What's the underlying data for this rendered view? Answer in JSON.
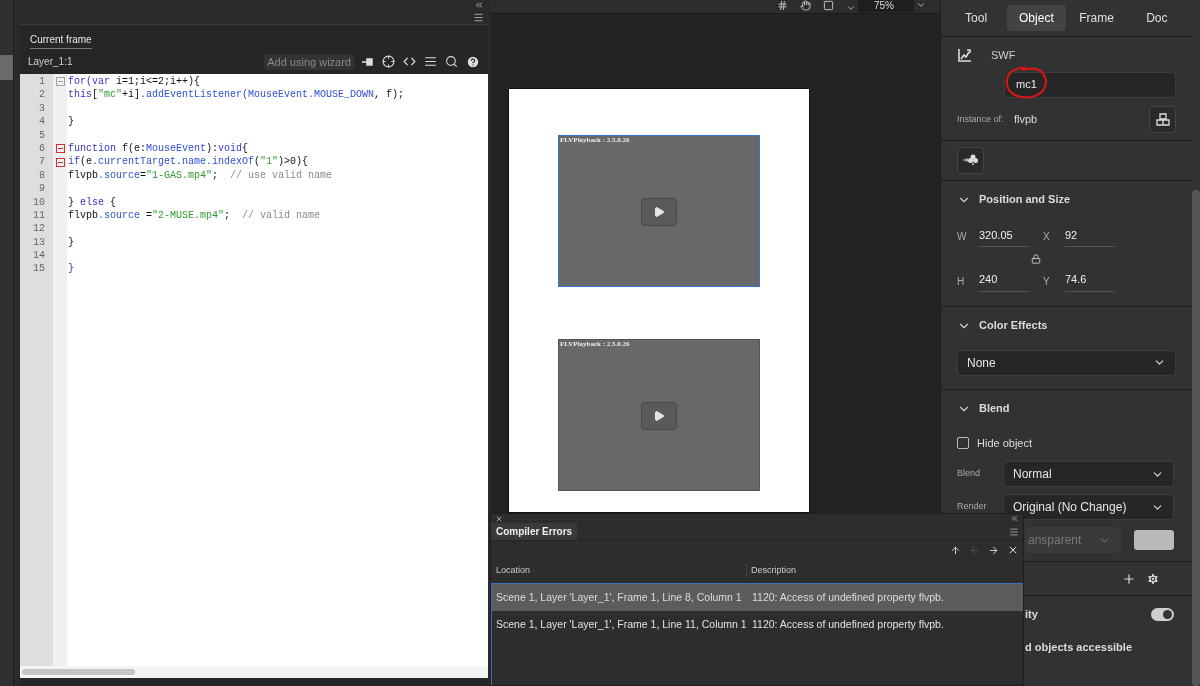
{
  "actions_panel": {
    "tab": "Current frame",
    "target": "Layer_1:1",
    "wizard_button": "Add using wizard",
    "code_lines": [
      {
        "number": "1",
        "color": "#a0a0a0",
        "segments": [
          {
            "kind": "keyword",
            "text": "for(var"
          },
          {
            "kind": "plain",
            "text": " i=1;i<=2;i++){"
          }
        ]
      },
      {
        "number": "2",
        "segments": [
          {
            "kind": "keyword",
            "text": "this"
          },
          {
            "kind": "plain",
            "text": "["
          },
          {
            "kind": "string",
            "text": "\"mc\""
          },
          {
            "kind": "plain",
            "text": "+i]"
          },
          {
            "kind": "member",
            "text": ".addEventListener(MouseEvent.MOUSE_DOWN"
          },
          {
            "kind": "plain",
            "text": ", f);"
          }
        ]
      },
      {
        "number": "3"
      },
      {
        "number": "4",
        "segments": [
          {
            "kind": "plain",
            "text": "}"
          }
        ]
      },
      {
        "number": "5"
      },
      {
        "number": "6",
        "color": "#d03030",
        "segments": [
          {
            "kind": "keyword",
            "text": "function"
          },
          {
            "kind": "plain",
            "text": " f(e:"
          },
          {
            "kind": "member",
            "text": "MouseEvent"
          },
          {
            "kind": "plain",
            "text": "):"
          },
          {
            "kind": "keyword",
            "text": "void"
          },
          {
            "kind": "plain",
            "text": "{"
          }
        ]
      },
      {
        "number": "7",
        "color": "#d03030",
        "segments": [
          {
            "kind": "keyword",
            "text": "if"
          },
          {
            "kind": "plain",
            "text": "(e"
          },
          {
            "kind": "member",
            "text": ".currentTarget.name.indexOf"
          },
          {
            "kind": "plain",
            "text": "("
          },
          {
            "kind": "string",
            "text": "\"1\""
          },
          {
            "kind": "plain",
            "text": ")>0){"
          }
        ]
      },
      {
        "number": "8",
        "segments": [
          {
            "kind": "plain",
            "text": "flvpb"
          },
          {
            "kind": "member",
            "text": ".source"
          },
          {
            "kind": "plain",
            "text": "="
          },
          {
            "kind": "string",
            "text": "\"1-GAS.mp4\""
          },
          {
            "kind": "plain",
            "text": ";  "
          },
          {
            "kind": "comment",
            "text": "// use valid name"
          }
        ]
      },
      {
        "number": "9"
      },
      {
        "number": "10",
        "segments": [
          {
            "kind": "plain",
            "text": "} "
          },
          {
            "kind": "keyword",
            "text": "else"
          },
          {
            "kind": "plain",
            "text": " {"
          }
        ]
      },
      {
        "number": "11",
        "segments": [
          {
            "kind": "plain",
            "text": "flvpb"
          },
          {
            "kind": "member",
            "text": ".source"
          },
          {
            "kind": "plain",
            "text": " ="
          },
          {
            "kind": "string",
            "text": "\"2-MUSE.mp4\""
          },
          {
            "kind": "plain",
            "text": ";  "
          },
          {
            "kind": "comment",
            "text": "// valid name"
          }
        ]
      },
      {
        "number": "12"
      },
      {
        "number": "13",
        "segments": [
          {
            "kind": "plain",
            "text": "}"
          }
        ]
      },
      {
        "number": "14"
      },
      {
        "number": "15",
        "segments": [
          {
            "kind": "keyword",
            "text": "}"
          }
        ]
      }
    ]
  },
  "stage": {
    "zoom": "75%",
    "players": [
      {
        "label": "FLVPlayback : 2.5.0.26",
        "selected": true
      },
      {
        "label": "FLVPlayback : 2.5.0.26",
        "selected": false
      }
    ]
  },
  "properties": {
    "tabs": [
      {
        "label": "Tool",
        "selected": false
      },
      {
        "label": "Object",
        "selected": true
      },
      {
        "label": "Frame",
        "selected": false
      },
      {
        "label": "Doc",
        "selected": false
      }
    ],
    "symbol_type": "SWF",
    "instance_name": "mc1",
    "instance_of_label": "Instance of:",
    "instance_of": "flvpb",
    "position_size": {
      "title": "Position and Size",
      "expanded": true,
      "fields": [
        {
          "label": "W",
          "value": "320.05"
        },
        {
          "label": "X",
          "value": "92"
        },
        {
          "label": "H",
          "value": "240"
        },
        {
          "label": "Y",
          "value": "74.6"
        }
      ]
    },
    "color_effects": {
      "title": "Color Effects",
      "expanded": true,
      "value": "None"
    },
    "blend": {
      "title": "Blend",
      "expanded": true,
      "hide_object": {
        "label": "Hide object",
        "checked": false
      },
      "blend": {
        "label": "Blend",
        "value": "Normal"
      },
      "render": {
        "label": "Render",
        "value": "Original (No Change)"
      },
      "background": {
        "value": "ansparent",
        "disabled": true
      }
    },
    "accessibility": {
      "label": "ity",
      "on": true
    },
    "accessible_note": "d objects accessible"
  },
  "compiler_errors": {
    "title": "Compiler Errors",
    "columns": [
      "Location",
      "Description"
    ],
    "rows": [
      {
        "location": "Scene 1, Layer 'Layer_1', Frame 1, Line 8, Column 1",
        "description": "1120: Access of undefined property flvpb.",
        "selected": true
      },
      {
        "location": "Scene 1, Layer 'Layer_1', Frame 1, Line 11, Column 1",
        "description": "1120: Access of undefined property flvpb.",
        "selected": false
      }
    ]
  }
}
